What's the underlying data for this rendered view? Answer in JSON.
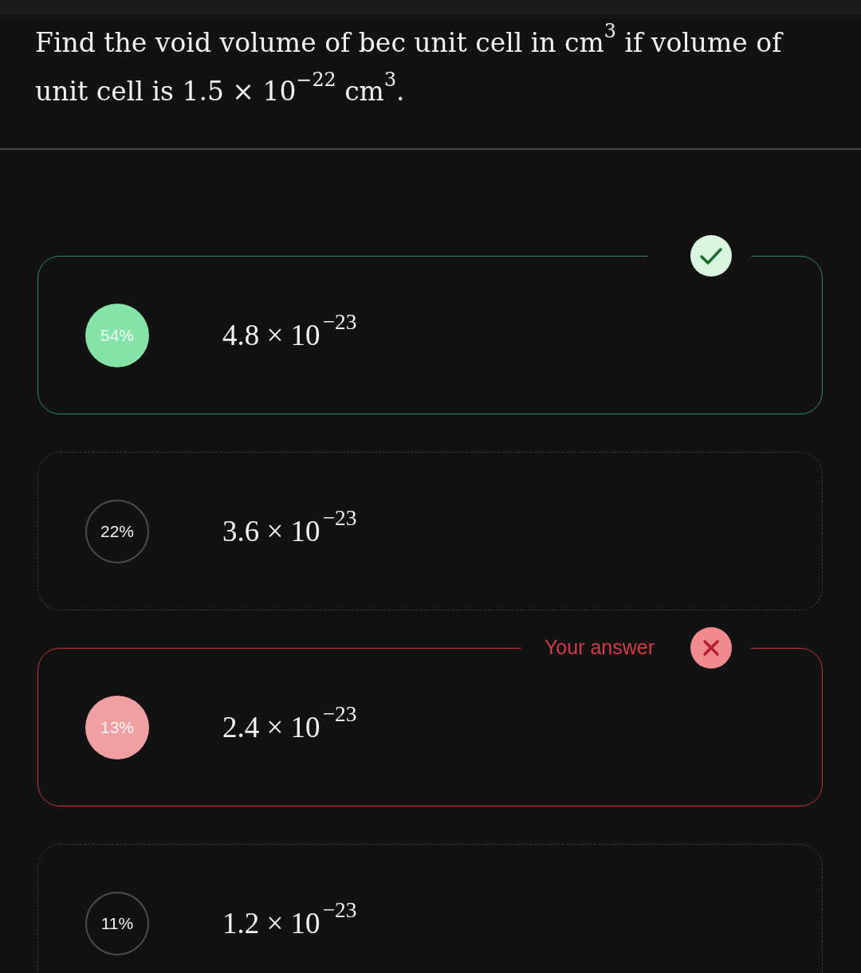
{
  "question": "Find the void volume of bec unit cell in cm$^{3}$ if volume of unit cell is 1.5 × 10$^{−22}$ cm$^{3}$.",
  "your_answer_label": "Your answer",
  "options": [
    {
      "percent": "54%",
      "answer": "4.8 × 10$^{−23}$",
      "correct": true,
      "selected": false
    },
    {
      "percent": "22%",
      "answer": "3.6 × 10$^{−23}$",
      "correct": false,
      "selected": false
    },
    {
      "percent": "13%",
      "answer": "2.4 × 10$^{−23}$",
      "correct": false,
      "selected": true
    },
    {
      "percent": "11%",
      "answer": "1.2 × 10$^{−23}$",
      "correct": false,
      "selected": false
    }
  ]
}
